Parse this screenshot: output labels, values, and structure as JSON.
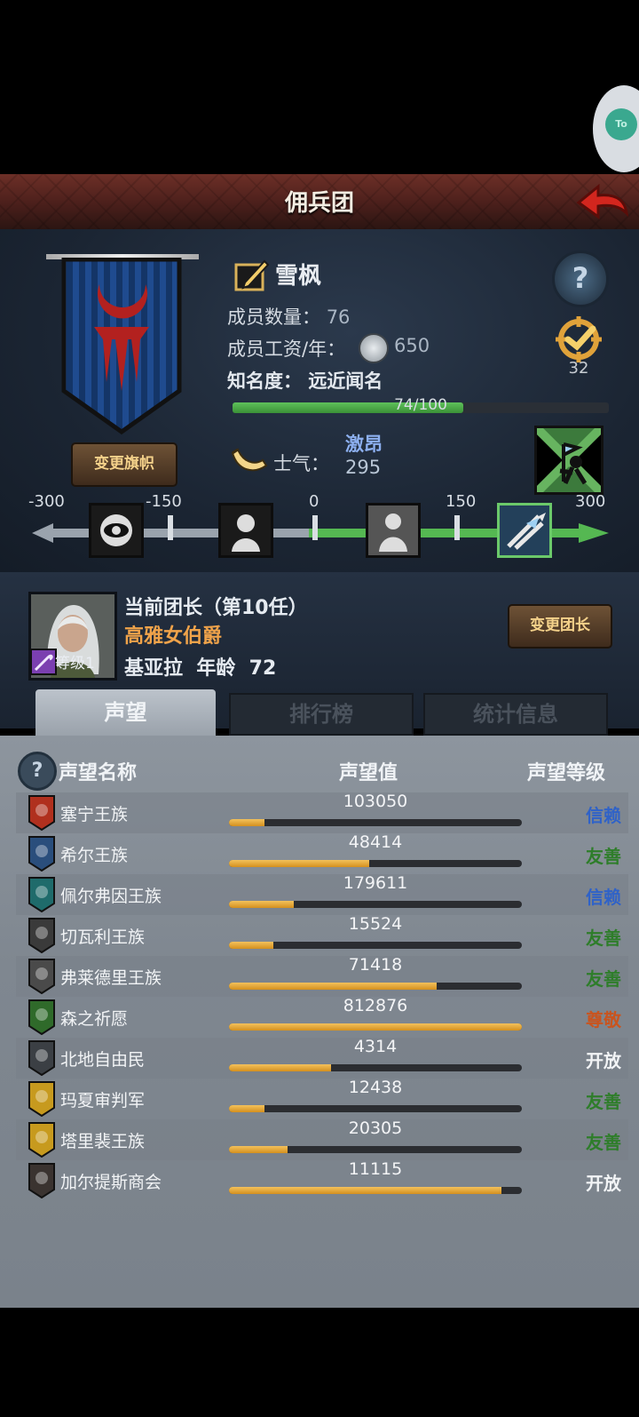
{
  "title": "佣兵团",
  "troop": {
    "name": "雪枫",
    "members_label": "成员数量：",
    "members_value": "76",
    "wage_label": "成员工资/年：",
    "wage_value": "650",
    "fame_label": "知名度：",
    "fame_value": "远近闻名",
    "fame_progress_text": "74/100",
    "fame_progress": 0.74,
    "change_banner_label": "变更旗帜",
    "target_count": "32"
  },
  "morale": {
    "label": "士气：",
    "state": "激昂",
    "value": "295",
    "scale": [
      "-300",
      "-150",
      "0",
      "150",
      "300"
    ],
    "current": 295
  },
  "leader": {
    "title": "当前团长（第10任）",
    "rank": "高雅女伯爵",
    "name_age": "基亚拉  年龄  72",
    "level": "等级1",
    "change_leader_label": "变更团长"
  },
  "tabs": [
    "声望",
    "排行榜",
    "统计信息"
  ],
  "reputation": {
    "headers": [
      "声望名称",
      "声望值",
      "声望等级"
    ],
    "rows": [
      {
        "name": "塞宁王族",
        "value": "103050",
        "fill": 0.12,
        "level": "信赖",
        "level_color": "#2f62c8",
        "crest_color": "#b0301e"
      },
      {
        "name": "希尔王族",
        "value": "48414",
        "fill": 0.48,
        "level": "友善",
        "level_color": "#2e7d2a",
        "crest_color": "#2a4e7c"
      },
      {
        "name": "佩尔弗因王族",
        "value": "179611",
        "fill": 0.22,
        "level": "信赖",
        "level_color": "#2f62c8",
        "crest_color": "#1f6b6b"
      },
      {
        "name": "切瓦利王族",
        "value": "15524",
        "fill": 0.15,
        "level": "友善",
        "level_color": "#2e7d2a",
        "crest_color": "#3a3a3a"
      },
      {
        "name": "弗莱德里王族",
        "value": "71418",
        "fill": 0.71,
        "level": "友善",
        "level_color": "#2e7d2a",
        "crest_color": "#4a4a4a"
      },
      {
        "name": "森之祈愿",
        "value": "812876",
        "fill": 1.0,
        "level": "尊敬",
        "level_color": "#c9541e",
        "crest_color": "#2f6a2a"
      },
      {
        "name": "北地自由民",
        "value": "4314",
        "fill": 0.35,
        "level": "开放",
        "level_color": "#f2f4f6",
        "crest_color": "#3b3f44"
      },
      {
        "name": "玛夏审判军",
        "value": "12438",
        "fill": 0.12,
        "level": "友善",
        "level_color": "#2e7d2a",
        "crest_color": "#c79a1e"
      },
      {
        "name": "塔里裴王族",
        "value": "20305",
        "fill": 0.2,
        "level": "友善",
        "level_color": "#2e7d2a",
        "crest_color": "#c79a1e"
      },
      {
        "name": "加尔提斯商会",
        "value": "11115",
        "fill": 0.93,
        "level": "开放",
        "level_color": "#f2f4f6",
        "crest_color": "#3a3330"
      }
    ]
  },
  "colors": {
    "accent": "#f0a34a",
    "fame_bar": "#4caa48",
    "morale_track": "#55b852"
  }
}
